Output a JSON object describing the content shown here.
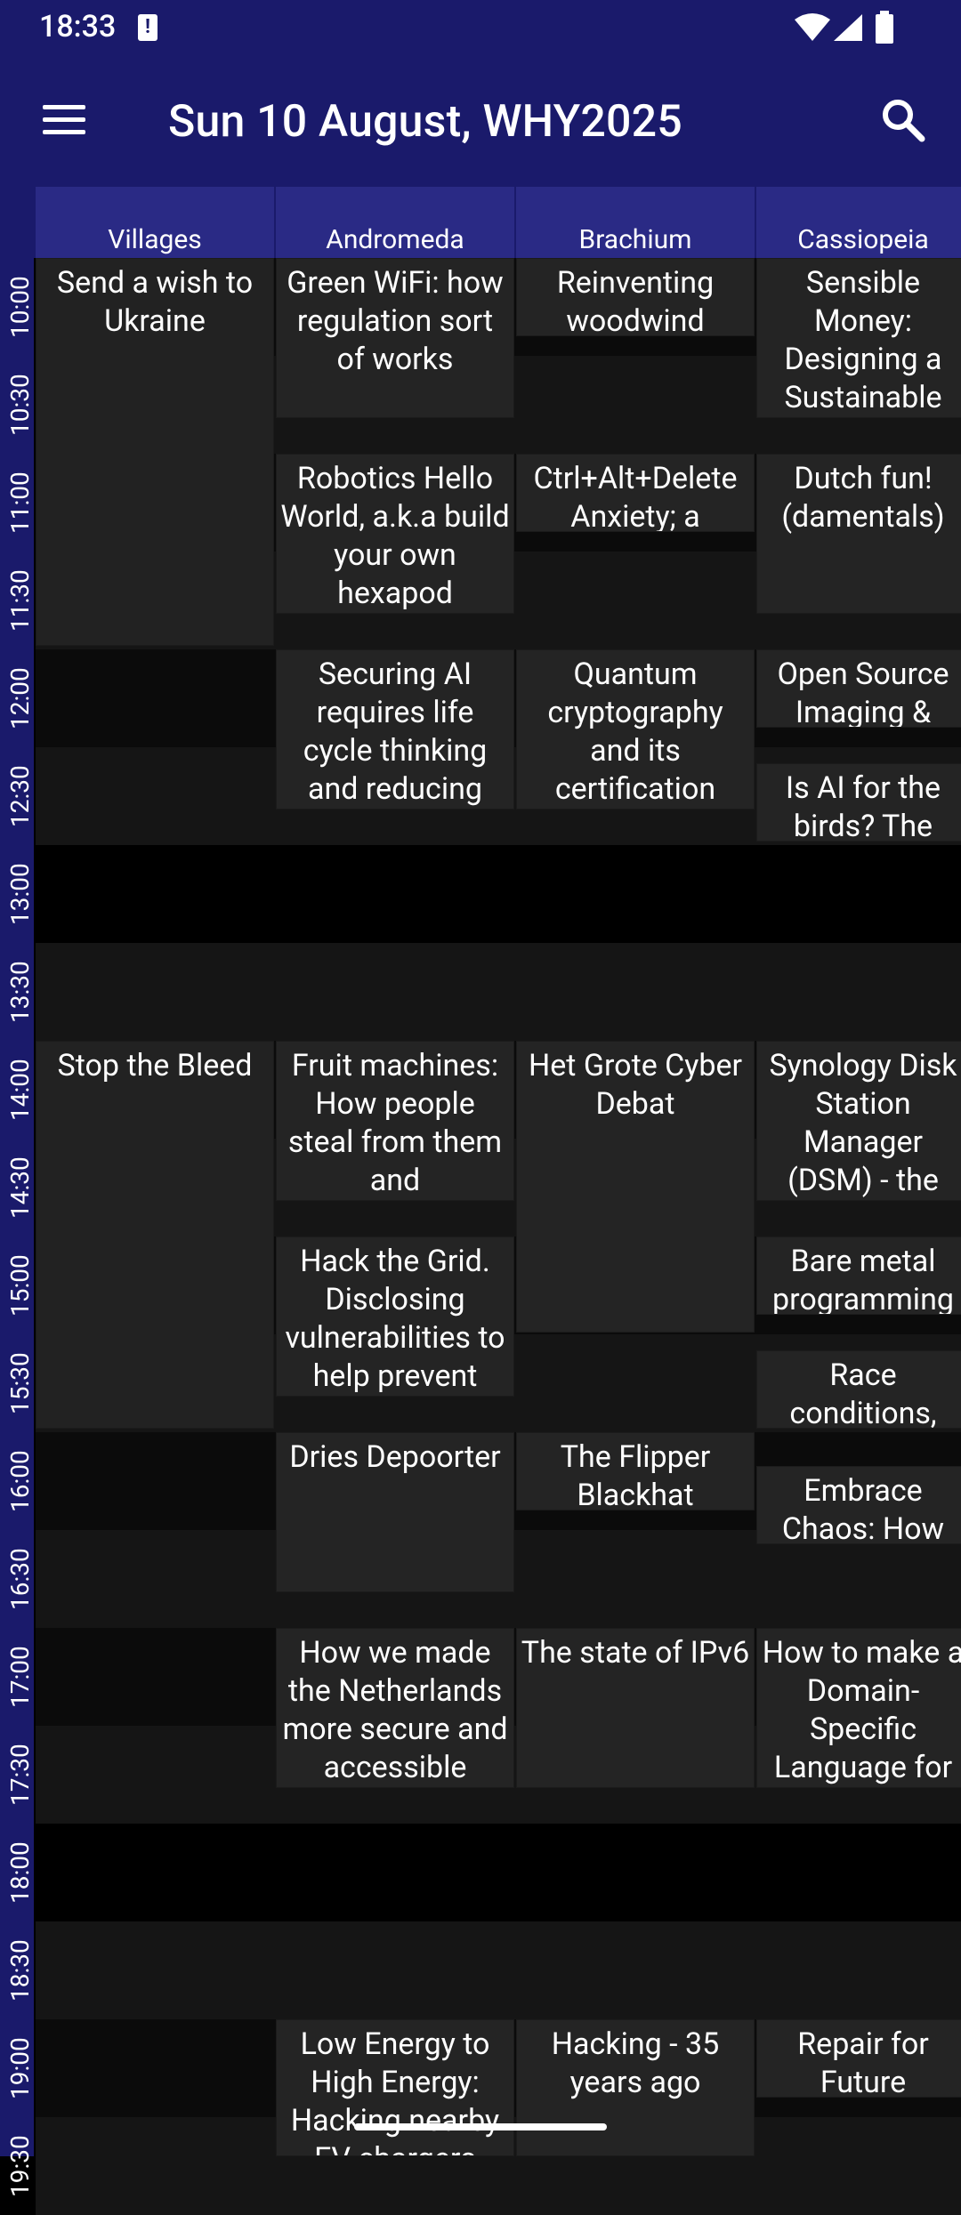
{
  "status": {
    "time": "18:33"
  },
  "appbar": {
    "title": "Sun 10 August, WHY2025"
  },
  "rooms": [
    "Villages",
    "Andromeda",
    "Brachium",
    "Cassiopeia"
  ],
  "times": [
    "10:00",
    "10:30",
    "11:00",
    "11:30",
    "12:00",
    "12:30",
    "13:00",
    "13:30",
    "14:00",
    "14:30",
    "15:00",
    "15:30",
    "16:00",
    "16:30",
    "17:00",
    "17:30",
    "18:00",
    "18:30",
    "19:00",
    "19:30"
  ],
  "events": [
    {
      "title": "Send a wish to Ukraine"
    },
    {
      "title": "Green WiFi: how regulation sort of works"
    },
    {
      "title": "Reinventing woodwind"
    },
    {
      "title": "Sensible Money: Designing a Sustainable Economy"
    },
    {
      "title": "Robotics Hello World, a.k.a build your own hexapod"
    },
    {
      "title": "Ctrl+Alt+Delete Anxiety; a"
    },
    {
      "title": "Dutch fun! (damentals)"
    },
    {
      "title": "Securing AI requires life cycle thinking and reducing"
    },
    {
      "title": "Quantum cryptography and its certification"
    },
    {
      "title": "Open Source Imaging &"
    },
    {
      "title": "Is AI for the birds? The"
    },
    {
      "title": "Stop the Bleed"
    },
    {
      "title": "Fruit machines: How people steal from them and"
    },
    {
      "title": "Het Grote Cyber Debat"
    },
    {
      "title": "Synology Disk Station Manager (DSM) - the good, the"
    },
    {
      "title": "Hack the Grid. Disclosing vulnerabilities to help prevent"
    },
    {
      "title": "Bare metal programming"
    },
    {
      "title": "Race conditions,"
    },
    {
      "title": "Dries Depoorter"
    },
    {
      "title": "The Flipper Blackhat"
    },
    {
      "title": "Embrace Chaos: How Game"
    },
    {
      "title": "How we made the Netherlands more secure and accessible"
    },
    {
      "title": "The state of IPv6"
    },
    {
      "title": "How to make a Domain-Specific Language for non-devs (so"
    },
    {
      "title": "Low Energy to High Energy: Hacking nearby EV chargers"
    },
    {
      "title": "Hacking - 35 years ago"
    },
    {
      "title": "Repair for Future"
    }
  ]
}
